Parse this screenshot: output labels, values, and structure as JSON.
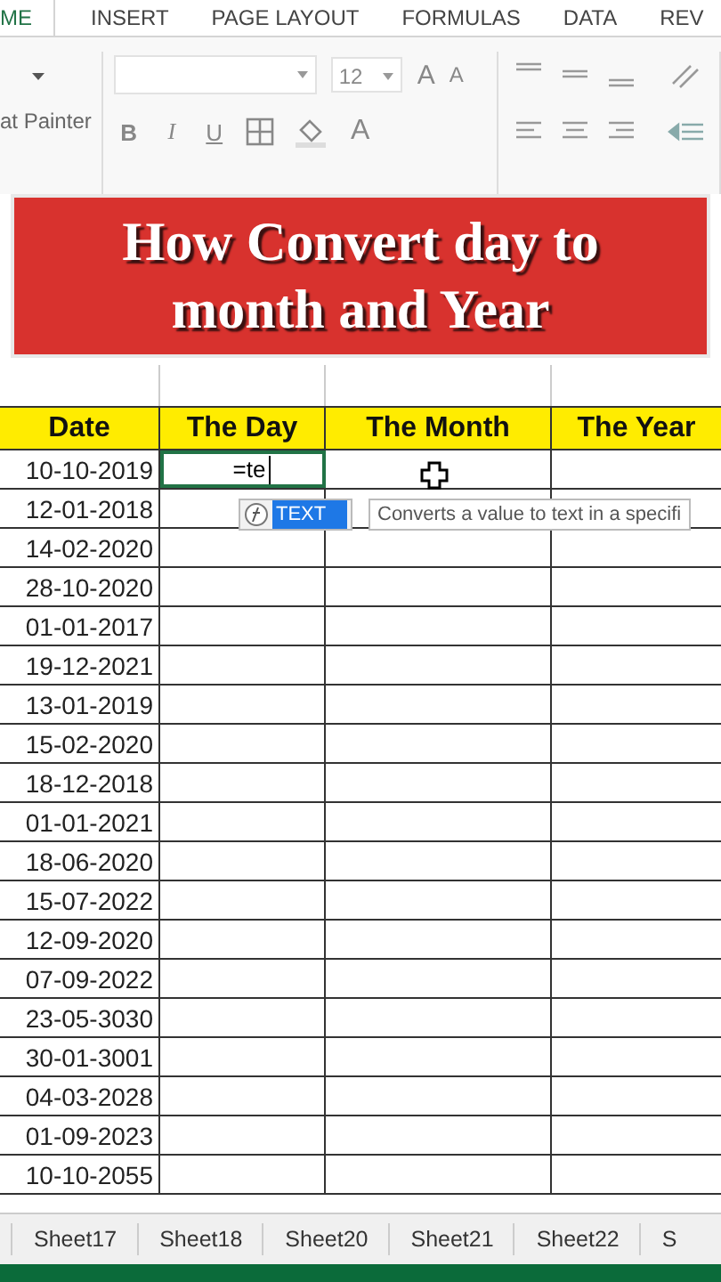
{
  "ribbon_tabs": [
    {
      "label": "ME",
      "selected": true
    },
    {
      "label": "INSERT",
      "selected": false
    },
    {
      "label": "PAGE LAYOUT",
      "selected": false
    },
    {
      "label": "FORMULAS",
      "selected": false
    },
    {
      "label": "DATA",
      "selected": false
    },
    {
      "label": "REV",
      "selected": false
    }
  ],
  "ribbon": {
    "format_painter": "at Painter",
    "font_size": "12",
    "grow_font": "A",
    "shrink_font": "A",
    "bold": "B",
    "italic": "I",
    "underline": "U",
    "font_color": "A"
  },
  "banner": {
    "lines": [
      "How Convert day to",
      "month and Year"
    ]
  },
  "sheet": {
    "columns": [
      "Date",
      "The Day",
      "The Month",
      "The Year"
    ],
    "active_cell_value": "=te",
    "rows": [
      "10-10-2019",
      "12-01-2018",
      "14-02-2020",
      "28-10-2020",
      "01-01-2017",
      "19-12-2021",
      "13-01-2019",
      "15-02-2020",
      "18-12-2018",
      "01-01-2021",
      "18-06-2020",
      "15-07-2022",
      "12-09-2020",
      "07-09-2022",
      "23-05-3030",
      "30-01-3001",
      "04-03-2028",
      "01-09-2023",
      "10-10-2055"
    ]
  },
  "autocomplete": {
    "items": [
      {
        "label": "TEXT",
        "selected": true
      }
    ],
    "tooltip": "Converts a value to text in a specifi"
  },
  "sheet_tabs": [
    {
      "label": "Sheet17",
      "selected": false
    },
    {
      "label": "Sheet18",
      "selected": false
    },
    {
      "label": "Sheet20",
      "selected": false
    },
    {
      "label": "Sheet21",
      "selected": false
    },
    {
      "label": "Sheet22",
      "selected": false
    },
    {
      "label": "S",
      "selected": false
    }
  ]
}
